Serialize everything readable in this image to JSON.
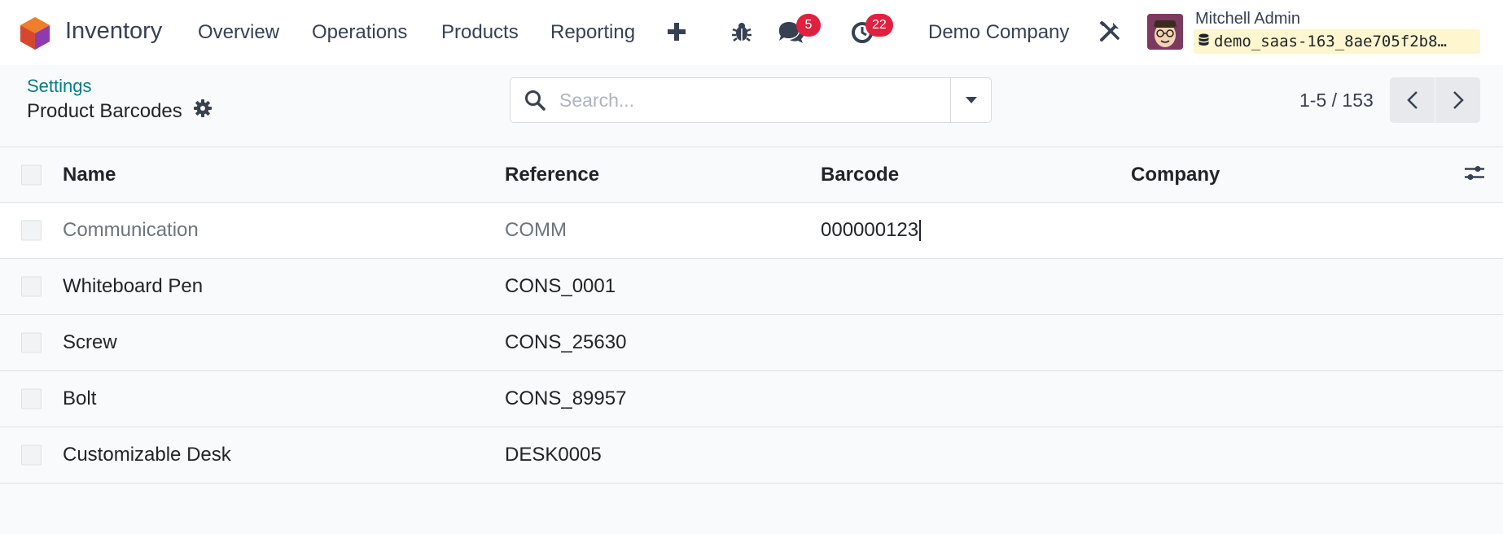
{
  "navbar": {
    "app_name": "Inventory",
    "menu": [
      "Overview",
      "Operations",
      "Products",
      "Reporting"
    ],
    "messages_count": "5",
    "activities_count": "22",
    "company": "Demo Company",
    "user_name": "Mitchell Admin",
    "database": "demo_saas-163_8ae705f2b8…",
    "colors": {
      "badge": "#e0203f",
      "db_chip": "#fdf6cf"
    }
  },
  "control_panel": {
    "breadcrumb": "Settings",
    "title": "Product Barcodes",
    "search_placeholder": "Search...",
    "pager": "1-5 / 153"
  },
  "table": {
    "columns": {
      "name": "Name",
      "reference": "Reference",
      "barcode": "Barcode",
      "company": "Company"
    },
    "rows": [
      {
        "name": "Communication",
        "reference": "COMM",
        "barcode": "000000123",
        "company": ""
      },
      {
        "name": "Whiteboard Pen",
        "reference": "CONS_0001",
        "barcode": "",
        "company": ""
      },
      {
        "name": "Screw",
        "reference": "CONS_25630",
        "barcode": "",
        "company": ""
      },
      {
        "name": "Bolt",
        "reference": "CONS_89957",
        "barcode": "",
        "company": ""
      },
      {
        "name": "Customizable Desk",
        "reference": "DESK0005",
        "barcode": "",
        "company": ""
      }
    ]
  },
  "accent_color": "#017e84"
}
